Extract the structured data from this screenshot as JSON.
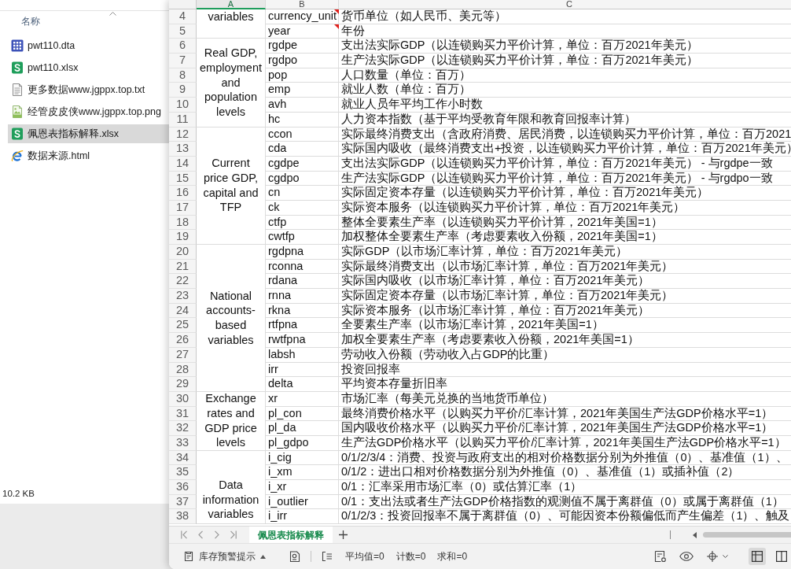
{
  "file_list": {
    "column_header": "名称",
    "files": [
      {
        "name": "pwt110.dta",
        "kind": "dta",
        "selected": false
      },
      {
        "name": "pwt110.xlsx",
        "kind": "xlsx",
        "selected": false
      },
      {
        "name": "更多数据www.jgppx.top.txt",
        "kind": "txt",
        "selected": false
      },
      {
        "name": "经管皮皮侠www.jgppx.top.png",
        "kind": "png",
        "selected": false
      },
      {
        "name": "佩恩表指标解释.xlsx",
        "kind": "xlsx",
        "selected": true
      },
      {
        "name": "数据来源.html",
        "kind": "html",
        "selected": false
      }
    ],
    "status": "10.2 KB"
  },
  "spreadsheet": {
    "columns": [
      {
        "label": "A",
        "selected": true
      },
      {
        "label": "B",
        "selected": false
      },
      {
        "label": "C",
        "selected": false
      }
    ],
    "groups": [
      {
        "label": "variables",
        "rows": [
          {
            "number": "4",
            "code": "currency_unit",
            "description": "货币单位（如人民币、美元等）",
            "has_comment": true
          },
          {
            "number": "5",
            "code": "year",
            "description": "年份",
            "has_comment": true
          }
        ]
      },
      {
        "label": "Real GDP, employment and population levels",
        "rows": [
          {
            "number": "6",
            "code": "rgdpe",
            "description": "支出法实际GDP（以连锁购买力平价计算，单位：百万2021年美元）",
            "has_comment": false
          },
          {
            "number": "7",
            "code": "rgdpo",
            "description": "生产法实际GDP（以连锁购买力平价计算，单位：百万2021年美元）",
            "has_comment": false
          },
          {
            "number": "8",
            "code": "pop",
            "description": "人口数量（单位：百万）",
            "has_comment": false
          },
          {
            "number": "9",
            "code": "emp",
            "description": "就业人数（单位：百万）",
            "has_comment": false
          },
          {
            "number": "10",
            "code": "avh",
            "description": "就业人员年平均工作小时数",
            "has_comment": false
          },
          {
            "number": "11",
            "code": "hc",
            "description": "人力资本指数（基于平均受教育年限和教育回报率计算）",
            "has_comment": false
          }
        ]
      },
      {
        "label": "Current price GDP, capital and TFP",
        "rows": [
          {
            "number": "12",
            "code": "ccon",
            "description": "实际最终消费支出（含政府消费、居民消费，以连锁购买力平价计算，单位：百万2021",
            "has_comment": false
          },
          {
            "number": "13",
            "code": "cda",
            "description": "实际国内吸收（最终消费支出+投资，以连锁购买力平价计算，单位：百万2021年美元）",
            "has_comment": false
          },
          {
            "number": "14",
            "code": "cgdpe",
            "description": "支出法实际GDP（以连锁购买力平价计算，单位：百万2021年美元） - 与rgdpe一致",
            "has_comment": false
          },
          {
            "number": "15",
            "code": "cgdpo",
            "description": "生产法实际GDP（以连锁购买力平价计算，单位：百万2021年美元） - 与rgdpo一致",
            "has_comment": false
          },
          {
            "number": "16",
            "code": "cn",
            "description": "实际固定资本存量（以连锁购买力平价计算，单位：百万2021年美元）",
            "has_comment": false
          },
          {
            "number": "17",
            "code": "ck",
            "description": "实际资本服务（以连锁购买力平价计算，单位：百万2021年美元）",
            "has_comment": false
          },
          {
            "number": "18",
            "code": "ctfp",
            "description": "整体全要素生产率（以连锁购买力平价计算，2021年美国=1）",
            "has_comment": false
          },
          {
            "number": "19",
            "code": "cwtfp",
            "description": "加权整体全要素生产率（考虑要素收入份额，2021年美国=1）",
            "has_comment": false
          }
        ]
      },
      {
        "label": "National accounts-based variables",
        "rows": [
          {
            "number": "20",
            "code": "rgdpna",
            "description": "实际GDP（以市场汇率计算，单位：百万2021年美元）",
            "has_comment": false
          },
          {
            "number": "21",
            "code": "rconna",
            "description": "实际最终消费支出（以市场汇率计算，单位：百万2021年美元）",
            "has_comment": false
          },
          {
            "number": "22",
            "code": "rdana",
            "description": "实际国内吸收（以市场汇率计算，单位：百万2021年美元）",
            "has_comment": false
          },
          {
            "number": "23",
            "code": "rnna",
            "description": "实际固定资本存量（以市场汇率计算，单位：百万2021年美元）",
            "has_comment": false
          },
          {
            "number": "24",
            "code": "rkna",
            "description": "实际资本服务（以市场汇率计算，单位：百万2021年美元）",
            "has_comment": false
          },
          {
            "number": "25",
            "code": "rtfpna",
            "description": "全要素生产率（以市场汇率计算，2021年美国=1）",
            "has_comment": false
          },
          {
            "number": "26",
            "code": "rwtfpna",
            "description": "加权全要素生产率（考虑要素收入份额，2021年美国=1）",
            "has_comment": false
          },
          {
            "number": "27",
            "code": "labsh",
            "description": "劳动收入份额（劳动收入占GDP的比重）",
            "has_comment": false
          },
          {
            "number": "28",
            "code": "irr",
            "description": "投资回报率",
            "has_comment": false
          },
          {
            "number": "29",
            "code": "delta",
            "description": "平均资本存量折旧率",
            "has_comment": false
          }
        ]
      },
      {
        "label": "Exchange rates and GDP price levels",
        "rows": [
          {
            "number": "30",
            "code": "xr",
            "description": "市场汇率（每美元兑换的当地货币单位）",
            "has_comment": false
          },
          {
            "number": "31",
            "code": "pl_con",
            "description": "最终消费价格水平（以购买力平价/汇率计算，2021年美国生产法GDP价格水平=1）",
            "has_comment": false
          },
          {
            "number": "32",
            "code": "pl_da",
            "description": "国内吸收价格水平（以购买力平价/汇率计算，2021年美国生产法GDP价格水平=1）",
            "has_comment": false
          },
          {
            "number": "33",
            "code": "pl_gdpo",
            "description": "生产法GDP价格水平（以购买力平价/汇率计算，2021年美国生产法GDP价格水平=1）",
            "has_comment": false
          }
        ]
      },
      {
        "label": "Data information variables",
        "rows": [
          {
            "number": "34",
            "code": "i_cig",
            "description": "0/1/2/3/4：消费、投资与政府支出的相对价格数据分别为外推值（0）、基准值（1）、",
            "has_comment": false
          },
          {
            "number": "35",
            "code": "i_xm",
            "description": "0/1/2：进出口相对价格数据分别为外推值（0）、基准值（1）或插补值（2）",
            "has_comment": false
          },
          {
            "number": "36",
            "code": "i_xr",
            "description": "0/1：汇率采用市场汇率（0）或估算汇率（1）",
            "has_comment": false
          },
          {
            "number": "37",
            "code": "i_outlier",
            "description": "0/1：支出法或者生产法GDP价格指数的观测值不属于离群值（0）或属于离群值（1）",
            "has_comment": false
          },
          {
            "number": "38",
            "code": "i_irr",
            "description": "0/1/2/3：投资回报率不属于离群值（0）、可能因资本份额偏低而产生偏差（1）、触及",
            "has_comment": false
          }
        ]
      }
    ],
    "sheet_tabs": [
      {
        "label": "佩恩表指标解释",
        "selected": true
      }
    ]
  },
  "status_bar": {
    "notice_button": "库存预警提示",
    "stats": [
      "平均值=0",
      "计数=0",
      "求和=0"
    ],
    "view_modes": [
      {
        "kind": "normal",
        "selected": true
      },
      {
        "kind": "page_break",
        "selected": false
      }
    ]
  }
}
